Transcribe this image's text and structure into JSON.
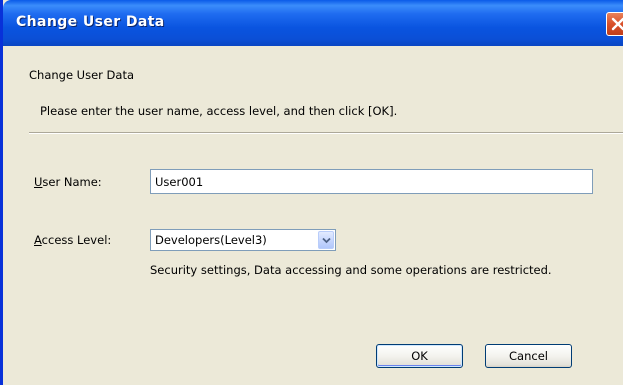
{
  "dialog": {
    "title": "Change User Data",
    "close_icon": "close-icon"
  },
  "header": {
    "heading": "Change User Data",
    "instruction": "Please enter the user name, access level, and then click [OK]."
  },
  "form": {
    "user_name": {
      "label_accel": "U",
      "label_rest": "ser Name:",
      "value": "User001"
    },
    "access_level": {
      "label_accel": "A",
      "label_rest": "ccess Level:",
      "selected": "Developers(Level3)",
      "description": "Security settings, Data accessing and some operations are restricted."
    }
  },
  "buttons": {
    "ok_label": "OK",
    "cancel_label": "Cancel"
  },
  "colors": {
    "titlebar": "#0a54e0",
    "dialog_background": "#ece9d8",
    "close_button": "#d9502a",
    "field_border": "#7f9db9"
  }
}
